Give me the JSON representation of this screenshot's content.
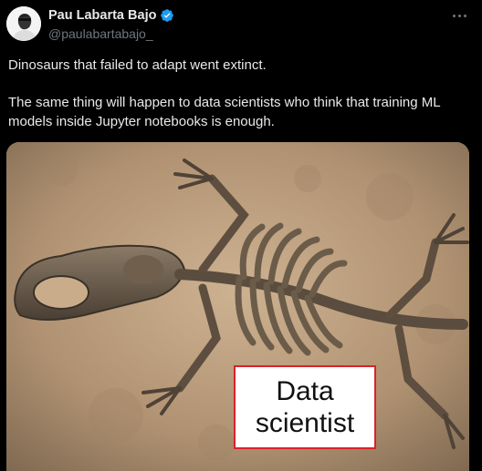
{
  "author": {
    "display_name": "Pau Labarta Bajo",
    "handle": "@paulabartabajo_",
    "verified_icon": "verified-badge-icon"
  },
  "more_icon": "more-options-icon",
  "tweet": {
    "line1": "Dinosaurs that failed to adapt went extinct.",
    "line2": "The same thing will happen to data scientists who think that training ML models inside Jupyter notebooks is enough."
  },
  "image": {
    "label": "Data scientist"
  },
  "colors": {
    "background": "#000000",
    "text": "#e7e9ea",
    "muted": "#71767b",
    "verified": "#1d9bf0",
    "label_border": "#d7232b"
  }
}
